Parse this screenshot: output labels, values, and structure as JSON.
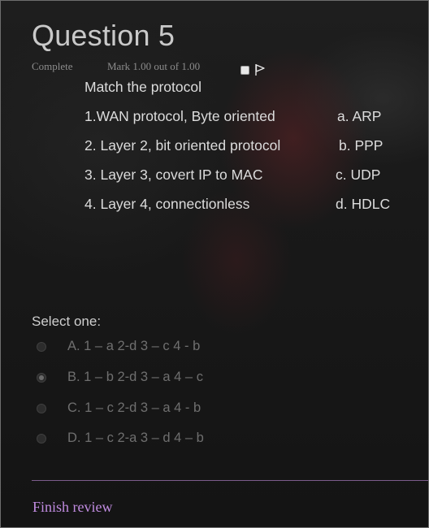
{
  "question": {
    "title": "Question 5",
    "state": "Complete",
    "mark": "Mark 1.00 out of 1.00",
    "prompt": "Match the protocol",
    "left_items": [
      "1.WAN protocol, Byte oriented",
      "2. Layer 2, bit oriented protocol",
      "3. Layer 3, covert IP to MAC",
      "4. Layer 4, connectionless"
    ],
    "right_items": [
      "a. ARP",
      "b. PPP",
      "c. UDP",
      "d. HDLC"
    ]
  },
  "answer": {
    "label": "Select one:",
    "options": [
      "A. 1 – a 2-d 3 – c 4 - b",
      "B. 1 – b 2-d 3 – a 4 – c",
      "C. 1 – c 2-d 3 – a 4 - b",
      "D. 1 – c 2-a 3 – d 4 – b"
    ],
    "selected_index": 1
  },
  "footer": {
    "finish_label": "Finish review"
  },
  "colors": {
    "link": "#c08be0",
    "divider": "#7c5c8c"
  }
}
